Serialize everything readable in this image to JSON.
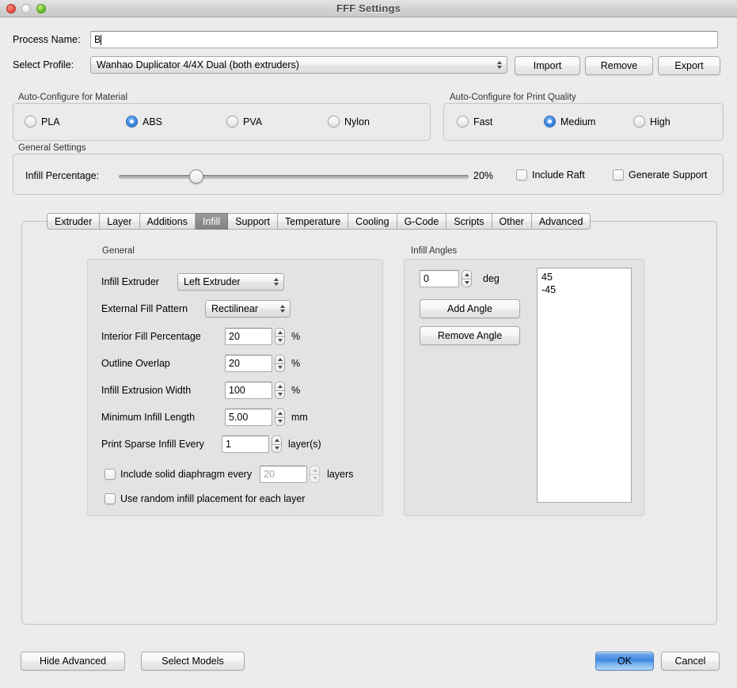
{
  "window": {
    "title": "FFF Settings",
    "traffic_lights": [
      "close-button",
      "minimize-button",
      "zoom-button"
    ]
  },
  "header": {
    "process_name_label": "Process Name:",
    "process_name_value": "B",
    "process_name_placeholder": "",
    "select_profile_label": "Select Profile:",
    "select_profile_value": "Wanhao Duplicator 4/4X Dual (both extruders)",
    "import_label": "Import",
    "remove_label": "Remove",
    "export_label": "Export"
  },
  "material": {
    "title": "Auto-Configure for Material",
    "options": [
      {
        "label": "PLA",
        "selected": false
      },
      {
        "label": "ABS",
        "selected": true
      },
      {
        "label": "PVA",
        "selected": false
      },
      {
        "label": "Nylon",
        "selected": false
      }
    ]
  },
  "quality": {
    "title": "Auto-Configure for Print Quality",
    "options": [
      {
        "label": "Fast",
        "selected": false
      },
      {
        "label": "Medium",
        "selected": true
      },
      {
        "label": "High",
        "selected": false
      }
    ]
  },
  "general_settings": {
    "title": "General Settings",
    "infill_label": "Infill Percentage:",
    "infill_value_text": "20%",
    "infill_percent": 20,
    "include_raft_label": "Include Raft",
    "include_raft_checked": false,
    "generate_support_label": "Generate Support",
    "generate_support_checked": false
  },
  "tabs": [
    {
      "label": "Extruder",
      "active": false
    },
    {
      "label": "Layer",
      "active": false
    },
    {
      "label": "Additions",
      "active": false
    },
    {
      "label": "Infill",
      "active": true
    },
    {
      "label": "Support",
      "active": false
    },
    {
      "label": "Temperature",
      "active": false
    },
    {
      "label": "Cooling",
      "active": false
    },
    {
      "label": "G-Code",
      "active": false
    },
    {
      "label": "Scripts",
      "active": false
    },
    {
      "label": "Other",
      "active": false
    },
    {
      "label": "Advanced",
      "active": false
    }
  ],
  "infill_general": {
    "title": "General",
    "infill_extruder_label": "Infill Extruder",
    "infill_extruder_value": "Left Extruder",
    "external_fill_pattern_label": "External Fill Pattern",
    "external_fill_pattern_value": "Rectilinear",
    "interior_fill_label": "Interior Fill Percentage",
    "interior_fill_value": "20",
    "interior_fill_unit": "%",
    "outline_overlap_label": "Outline Overlap",
    "outline_overlap_value": "20",
    "outline_overlap_unit": "%",
    "infill_extrusion_width_label": "Infill Extrusion Width",
    "infill_extrusion_width_value": "100",
    "infill_extrusion_width_unit": "%",
    "minimum_infill_length_label": "Minimum Infill Length",
    "minimum_infill_length_value": "5.00",
    "minimum_infill_length_unit": "mm",
    "print_sparse_every_label": "Print Sparse Infill Every",
    "print_sparse_every_value": "1",
    "print_sparse_every_unit": "layer(s)",
    "diaphragm_label": "Include solid diaphragm every",
    "diaphragm_value": "20",
    "diaphragm_unit": "layers",
    "diaphragm_checked": false,
    "random_placement_label": "Use random infill placement for each layer",
    "random_placement_checked": false
  },
  "infill_angles": {
    "title": "Infill Angles",
    "angle_input_value": "0",
    "deg_label": "deg",
    "add_angle_label": "Add Angle",
    "remove_angle_label": "Remove Angle",
    "angles": [
      "45",
      "-45"
    ]
  },
  "footer": {
    "hide_advanced_label": "Hide Advanced",
    "select_models_label": "Select Models",
    "ok_label": "OK",
    "cancel_label": "Cancel"
  },
  "colors": {
    "window_bg": "#ececec",
    "accent_blue": "#3d87e0",
    "radio_selected": "#2f7fdd",
    "active_tab": "#8d8d8d",
    "field_bg": "#ffffff"
  }
}
